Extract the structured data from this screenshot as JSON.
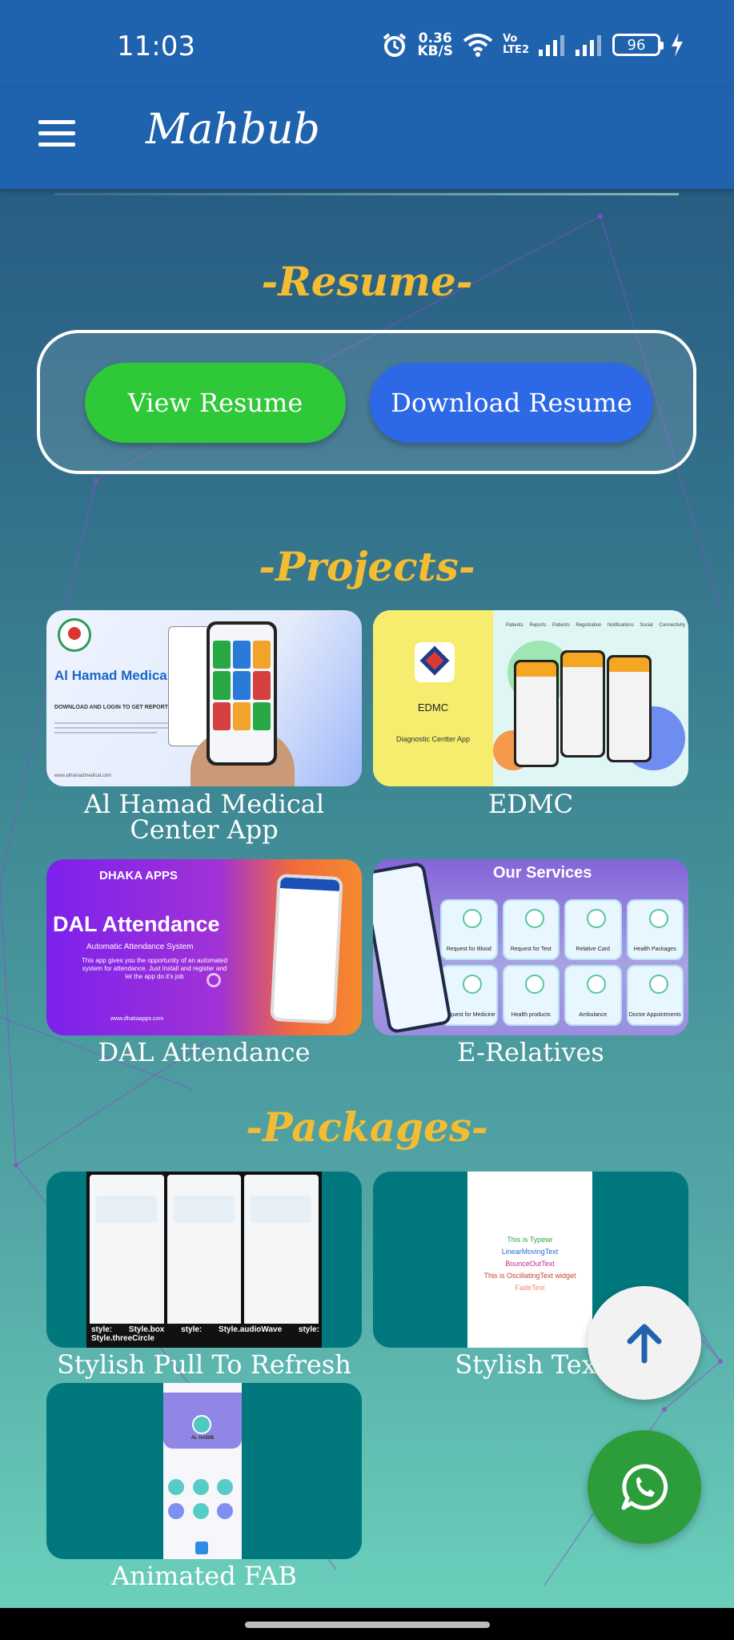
{
  "status_bar": {
    "time": "11:03",
    "net_speed_value": "0.36",
    "net_speed_unit": "KB/S",
    "volte_top": "Vo",
    "volte_bottom": "LTE2",
    "battery": "96"
  },
  "app_bar": {
    "title": "Mahbub"
  },
  "resume": {
    "heading": "-Resume-",
    "view_label": "View Resume",
    "download_label": "Download Resume"
  },
  "projects": {
    "heading": "-Projects-",
    "items": [
      {
        "label": "Al Hamad Medical Center App",
        "thumb_title": "Al Hamad Medical Center",
        "thumb_subtitle": "DOWNLOAD AND LOGIN TO GET REPORTS",
        "thumb_url": "www.alhamadmedical.com"
      },
      {
        "label": "EDMC",
        "thumb_title": "EDMC",
        "thumb_subtitle": "Diagnostic Centter App",
        "thumb_menu": "Patients Reports Patients Registration Notifications Social Connectivity"
      },
      {
        "label": "DAL Attendance",
        "thumb_brand": "DHAKA APPS",
        "thumb_title": "DAL Attendance",
        "thumb_subtitle": "Automatic Attendance System",
        "thumb_desc": "This app gives you the opportunity of an automated system for attendance. Just install and register and let the app do it's job",
        "thumb_url": "www.dhakaapps.com"
      },
      {
        "label": "E-Relatives",
        "thumb_title": "Our Services",
        "services": [
          "Request for Blood",
          "Request for Test",
          "Relative Card",
          "Health Packages",
          "Request for Medicine",
          "Health products",
          "Ambulance",
          "Doctor Appointments"
        ]
      }
    ]
  },
  "packages": {
    "heading": "-Packages-",
    "items": [
      {
        "label": "Stylish Pull To Refresh",
        "thumb_caption": "style: Style.box style: Style.audioWave style: Style.threeCircle"
      },
      {
        "label": "Stylish Text",
        "thumb_lines": [
          "This is Typewr",
          "LinearMovingText",
          "BounceOutText",
          "This is OscillatingText widget",
          "FadeText"
        ]
      },
      {
        "label": "Animated FAB",
        "thumb_name": "AL HABIB"
      }
    ]
  },
  "colors": {
    "app_bar": "#1f62ad",
    "heading": "#f3bd33",
    "view_button": "#2ec838",
    "download_button": "#2d68e6",
    "package_card": "#00787d",
    "whatsapp": "#2d9d3c"
  },
  "icons": {
    "menu": "hamburger-menu-icon",
    "scroll_top": "arrow-up-icon",
    "whatsapp": "whatsapp-icon"
  }
}
